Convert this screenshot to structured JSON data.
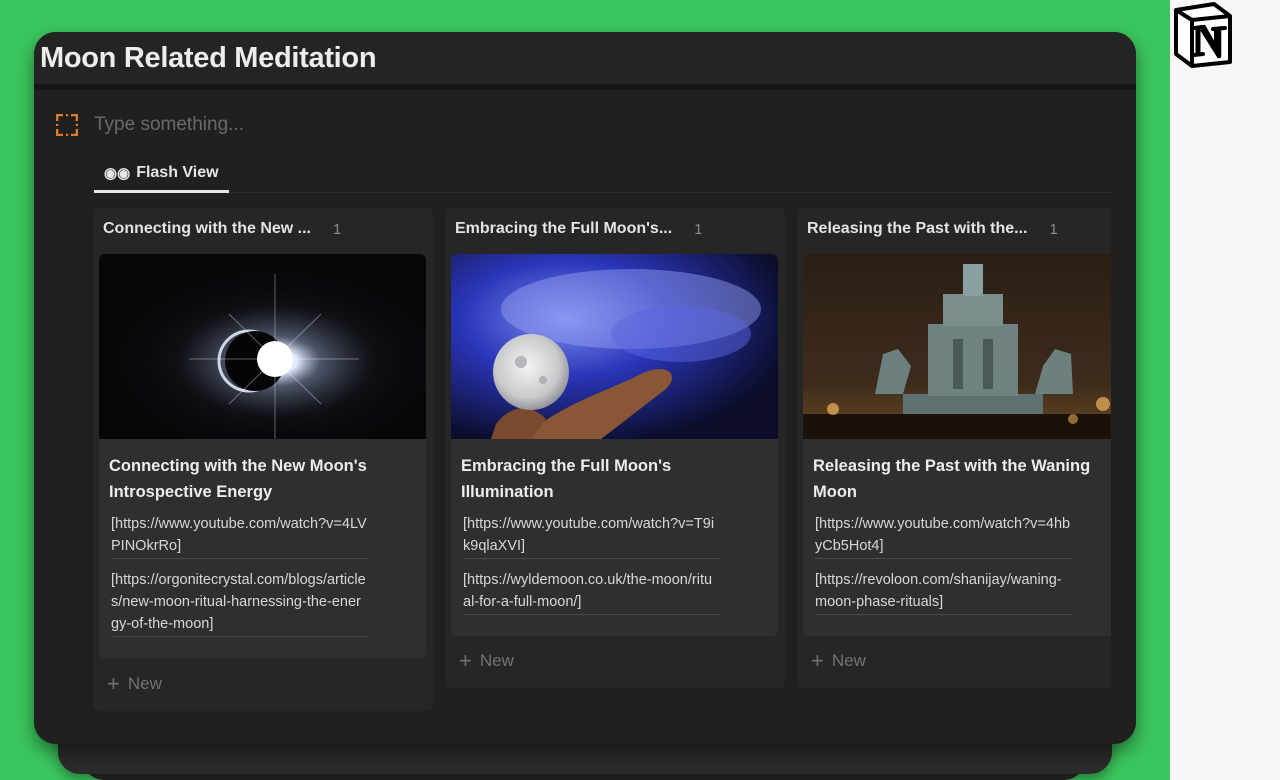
{
  "window": {
    "title": "Moon Related Meditation"
  },
  "input": {
    "placeholder": "Type something..."
  },
  "tabs": [
    {
      "label": "Flash View",
      "icon": "binoculars-icon"
    }
  ],
  "columns": [
    {
      "title": "Connecting with the New ...",
      "count": "1",
      "card": {
        "title": "Connecting with the New Moon's Introspective Energy",
        "links": [
          "[https://www.youtube.com/watch?v=4LVPINOkrRo]",
          "[https://orgonitecrystal.com/blogs/articles/new-moon-ritual-harnessing-the-energy-of-the-moon]"
        ]
      },
      "new_label": "New"
    },
    {
      "title": "Embracing the Full Moon's...",
      "count": "1",
      "card": {
        "title": "Embracing the Full Moon's Illumination",
        "links": [
          "[https://www.youtube.com/watch?v=T9ik9qlaXVI]",
          "[https://wyldemoon.co.uk/the-moon/ritual-for-a-full-moon/]"
        ]
      },
      "new_label": "New"
    },
    {
      "title": "Releasing the Past with the...",
      "count": "1",
      "card": {
        "title": "Releasing the Past with the Waning Moon",
        "links": [
          "[https://www.youtube.com/watch?v=4hbyCb5Hot4]",
          "[https://revoloon.com/shanijay/waning-moon-phase-rituals]"
        ]
      },
      "new_label": "New"
    }
  ],
  "colors": {
    "background": "#3bc65d",
    "window": "#1f1f1f",
    "card": "#2f2f2f",
    "accent_icon": "#e07b28"
  }
}
